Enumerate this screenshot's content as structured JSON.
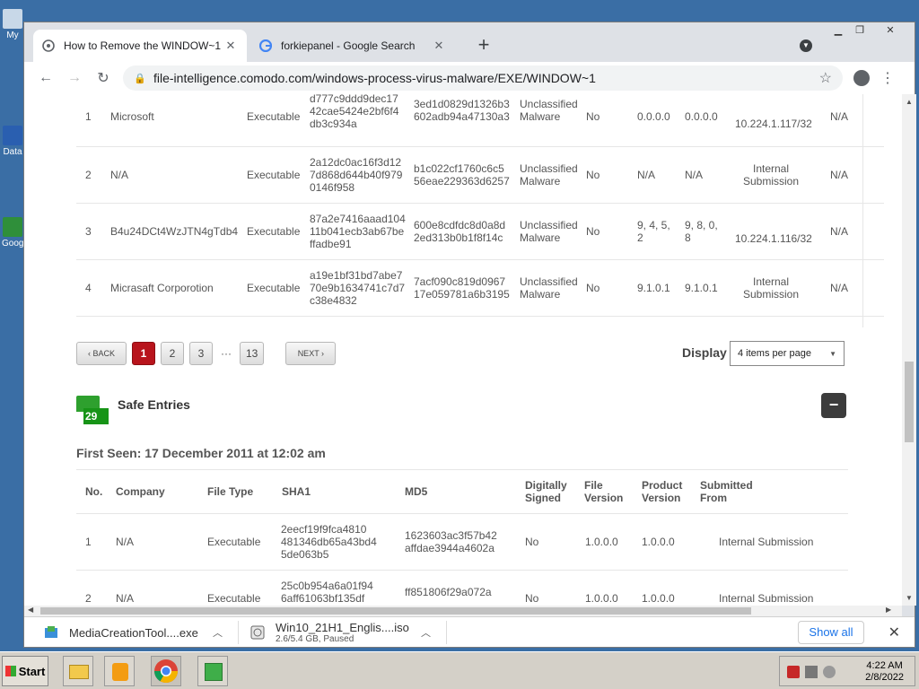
{
  "desktop": {
    "icons": [
      {
        "label": "My",
        "icon": "computer-icon"
      },
      {
        "label": "Data",
        "icon": "app-icon"
      },
      {
        "label": "Goog",
        "icon": "app-icon"
      }
    ]
  },
  "browser": {
    "tabs": [
      {
        "title": "How to Remove the WINDOW~1",
        "icon": "page-icon",
        "close": "✕"
      },
      {
        "title": "forkiepanel - Google Search",
        "icon": "google-icon",
        "close": "✕"
      }
    ],
    "new_tab": "+",
    "url": "file-intelligence.comodo.com/windows-process-virus-malware/EXE/WINDOW~1"
  },
  "unsafe_rows": [
    {
      "no": "1",
      "company": "Microsoft",
      "type": "Executable",
      "sha1": "d777c9ddd9dec17 42cae5424e2bf6f4 db3c934a",
      "md5": "3ed1d0829d1326b3 602adb94a47130a3",
      "verdict": "Unclassified Malware",
      "signed": "No",
      "file_version": "0.0.0.0",
      "product_version": "0.0.0.0",
      "submitted": "10.224.1.117/32",
      "extra": "N/A"
    },
    {
      "no": "2",
      "company": "N/A",
      "type": "Executable",
      "sha1": "2a12dc0ac16f3d12 7d868d644b40f979 0146f958",
      "md5": "b1c022cf1760c6c5 56eae229363d6257",
      "verdict": "Unclassified Malware",
      "signed": "No",
      "file_version": "N/A",
      "product_version": "N/A",
      "submitted": "Internal Submission",
      "extra": "N/A"
    },
    {
      "no": "3",
      "company": "B4u24DCt4WzJTN4gTdb4",
      "type": "Executable",
      "sha1": "87a2e7416aaad104 11b041ecb3ab67be ffadbe91",
      "md5": "600e8cdfdc8d0a8d 2ed313b0b1f8f14c",
      "verdict": "Unclassified Malware",
      "signed": "No",
      "file_version": "9, 4, 5, 2",
      "product_version": "9, 8, 0, 8",
      "submitted": "10.224.1.116/32",
      "extra": "N/A"
    },
    {
      "no": "4",
      "company": "Micrasaft Corporotion",
      "type": "Executable",
      "sha1": "a19e1bf31bd7abe7 70e9b1634741c7d7 c38e4832",
      "md5": "7acf090c819d0967 17e059781a6b3195",
      "verdict": "Unclassified Malware",
      "signed": "No",
      "file_version": "9.1.0.1",
      "product_version": "9.1.0.1",
      "submitted": "Internal Submission",
      "extra": "N/A"
    }
  ],
  "pagination": {
    "back": "‹ BACK",
    "pages": [
      "1",
      "2",
      "3"
    ],
    "ellipsis": "···",
    "last": "13",
    "next": "NEXT ›",
    "current": "1",
    "display_label": "Display",
    "display_value": "4 items per page"
  },
  "safe": {
    "count": "29",
    "title": "Safe Entries",
    "first_seen": "First Seen: 17 December 2011 at 12:02 am",
    "columns": [
      "No.",
      "Company",
      "File Type",
      "SHA1",
      "MD5",
      "Digitally Signed",
      "File Version",
      "Product Version",
      "Submitted From"
    ],
    "rows": [
      {
        "no": "1",
        "company": "N/A",
        "type": "Executable",
        "sha1": "2eecf19f9fca4810 481346db65a43bd4 5de063b5",
        "md5": "1623603ac3f57b42 affdae3944a4602a",
        "signed": "No",
        "file_version": "1.0.0.0",
        "product_version": "1.0.0.0",
        "submitted": "Internal Submission"
      },
      {
        "no": "2",
        "company": "N/A",
        "type": "Executable",
        "sha1": "25c0b954a6a01f94 6aff61063bf135df",
        "md5": "ff851806f29a072a",
        "signed": "No",
        "file_version": "1.0.0.0",
        "product_version": "1.0.0.0",
        "submitted": "Internal Submission"
      }
    ]
  },
  "downloads": {
    "items": [
      {
        "name": "MediaCreationTool....exe",
        "status": ""
      },
      {
        "name": "Win10_21H1_Englis....iso",
        "status": "2.6/5.4 GB, Paused"
      }
    ],
    "show_all": "Show all"
  },
  "taskbar": {
    "start": "Start",
    "time": "4:22 AM",
    "date": "2/8/2022"
  },
  "colors": {
    "accent_red": "#b8141c",
    "safe_green": "#179417",
    "link_blue": "#1a73e8"
  }
}
